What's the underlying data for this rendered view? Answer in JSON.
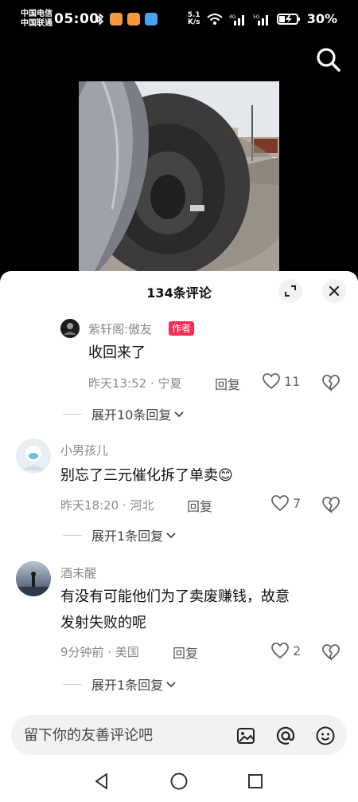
{
  "status_bar": {
    "carrier1": "中国电信",
    "carrier2": "中国联通",
    "time": "05:00",
    "net_speed_value": "5.1",
    "net_speed_unit": "K/s",
    "battery": "30%"
  },
  "comments_panel": {
    "title": "134条评论",
    "comments": [
      {
        "user": "紫轩阁:傲友",
        "tag": "作者",
        "text": "收回来了",
        "time_loc": "昨天13:52 · 宁夏",
        "reply_label": "回复",
        "likes": "11",
        "expand": "展开10条回复"
      },
      {
        "user": "小男孩儿",
        "text": "别忘了三元催化拆了单卖",
        "emoji": "😊",
        "time_loc": "昨天18:20 · 河北",
        "reply_label": "回复",
        "likes": "7",
        "expand": "展开1条回复"
      },
      {
        "user": "酒未醒",
        "text_line1": "有没有可能他们为了卖废赚钱，故意",
        "text_line2": "发射失败的呢",
        "time_loc": "9分钟前 · 美国",
        "reply_label": "回复",
        "likes": "2",
        "expand": "展开1条回复"
      }
    ],
    "input_placeholder": "留下你的友善评论吧"
  },
  "icons": [
    "search-icon",
    "expand-icon",
    "close-icon",
    "heart-icon",
    "broken-heart-icon",
    "chevron-down-icon",
    "image-icon",
    "at-icon",
    "emoji-icon",
    "back-icon",
    "home-icon",
    "recents-icon"
  ]
}
